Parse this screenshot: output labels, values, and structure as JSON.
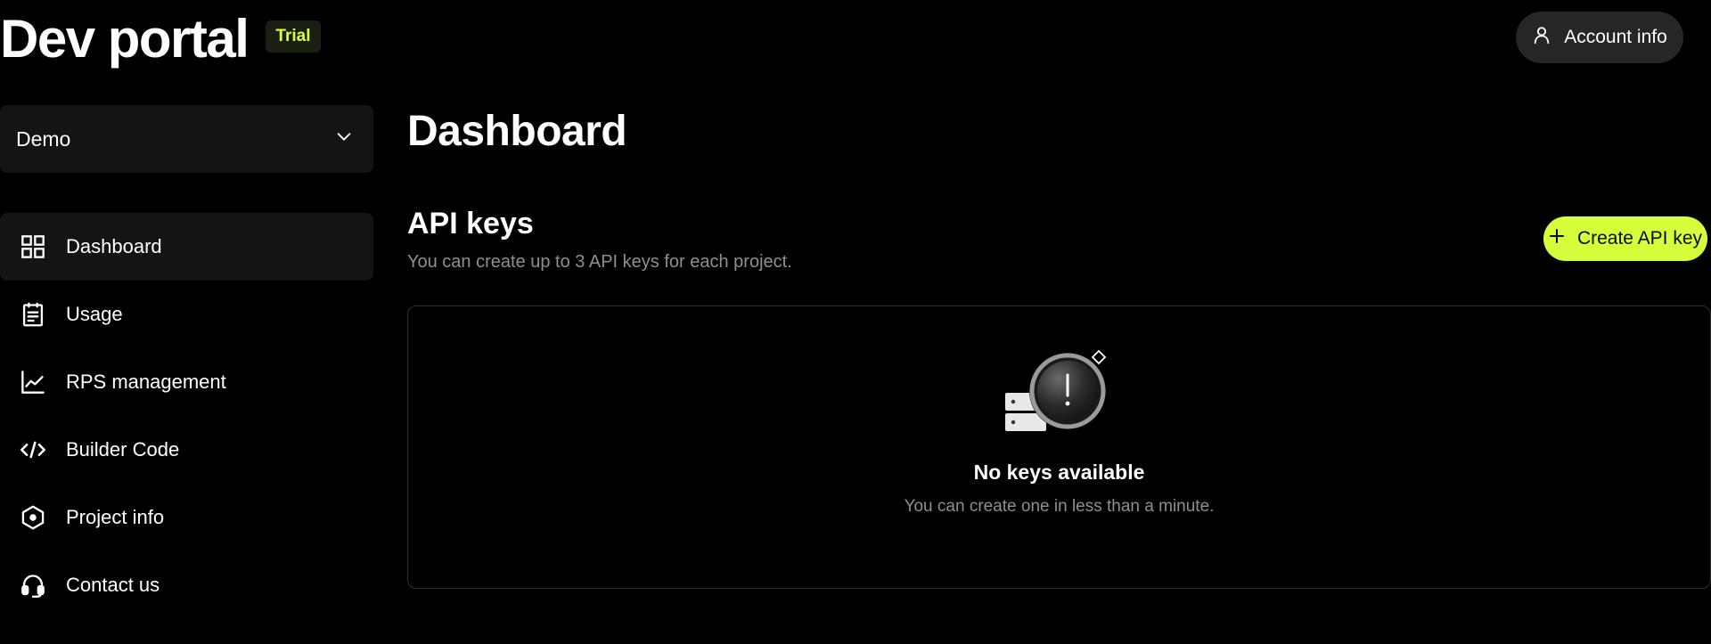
{
  "header": {
    "title": "Dev portal",
    "badge": "Trial",
    "account_label": "Account info"
  },
  "sidebar": {
    "project_selector": "Demo",
    "items": [
      {
        "label": "Dashboard",
        "icon": "grid-icon",
        "active": true
      },
      {
        "label": "Usage",
        "icon": "clipboard-icon",
        "active": false
      },
      {
        "label": "RPS management",
        "icon": "chart-line-icon",
        "active": false
      },
      {
        "label": "Builder Code",
        "icon": "code-icon",
        "active": false
      },
      {
        "label": "Project info",
        "icon": "hexagon-icon",
        "active": false
      },
      {
        "label": "Contact us",
        "icon": "headset-icon",
        "active": false
      }
    ]
  },
  "main": {
    "page_title": "Dashboard",
    "section_title": "API keys",
    "section_subtitle": "You can create up to 3 API keys for each project.",
    "create_button": "Create API key",
    "empty_title": "No keys available",
    "empty_subtitle": "You can create one in less than a minute."
  },
  "colors": {
    "background": "#000000",
    "accent": "#d4ff3a",
    "surface": "#141414",
    "muted_text": "#8f8f8f"
  }
}
